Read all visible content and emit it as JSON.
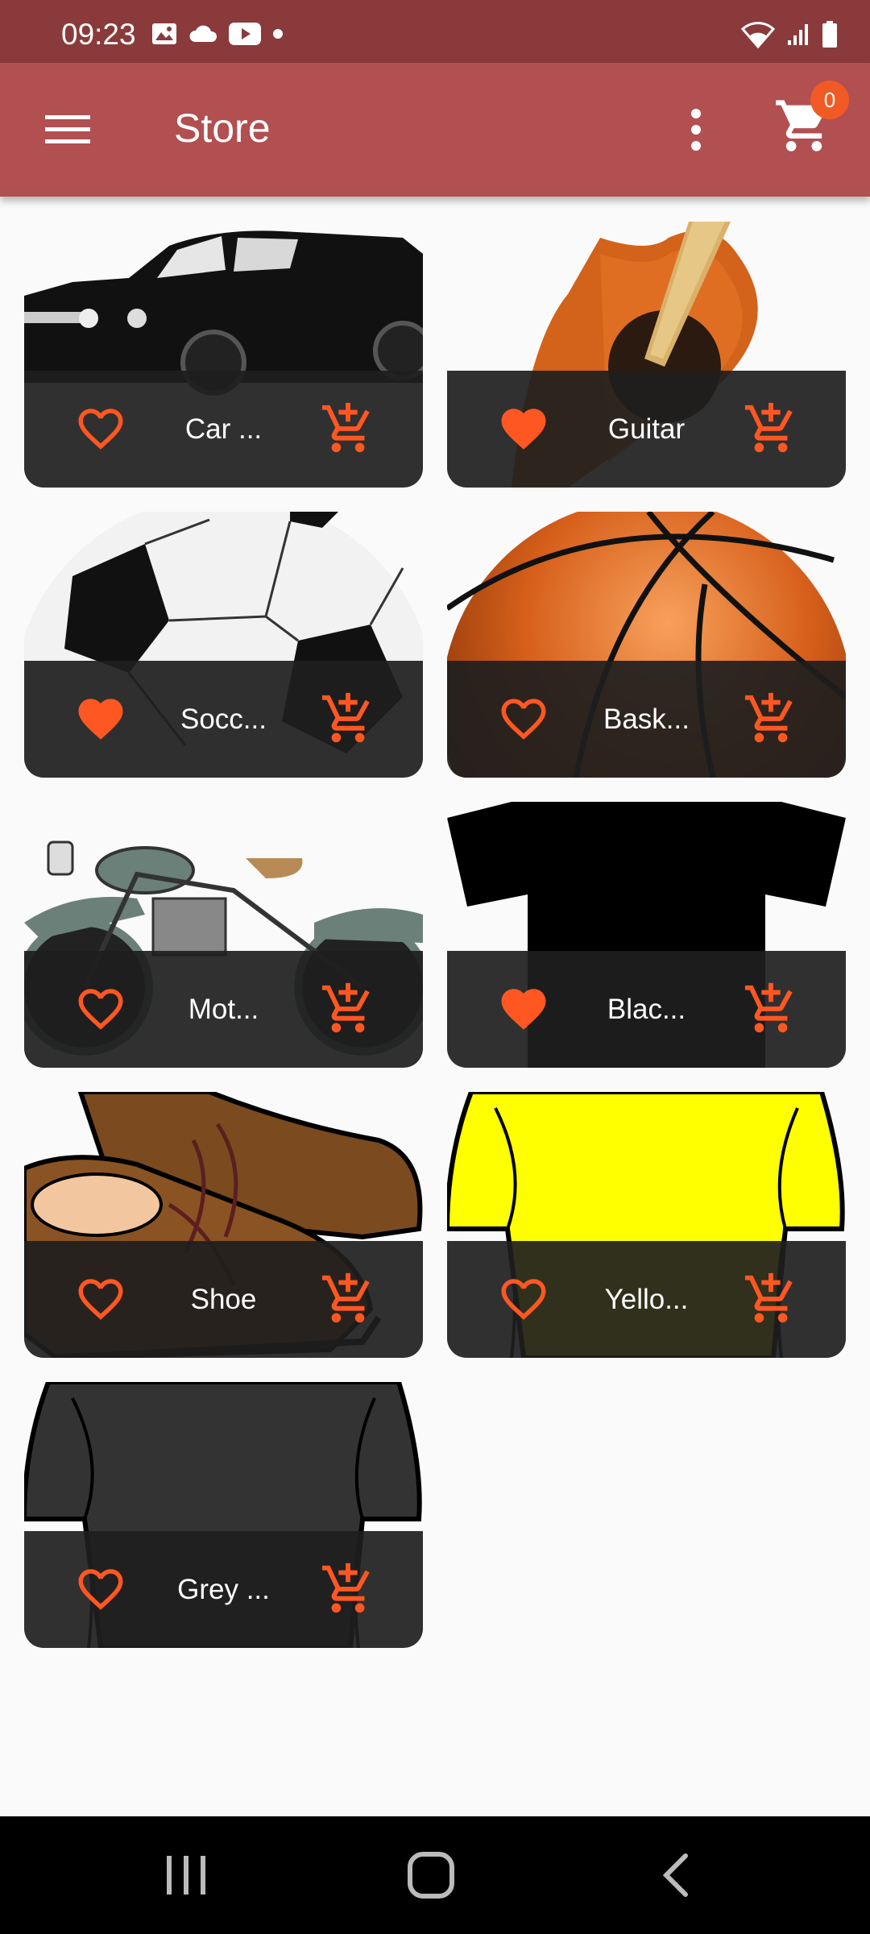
{
  "status": {
    "time": "09:23"
  },
  "app_bar": {
    "title": "Store",
    "cart_count": "0"
  },
  "products": [
    {
      "name": "Car ...",
      "favorite": false
    },
    {
      "name": "Guitar",
      "favorite": true
    },
    {
      "name": "Socc...",
      "favorite": true
    },
    {
      "name": "Bask...",
      "favorite": false
    },
    {
      "name": "Mot...",
      "favorite": false
    },
    {
      "name": "Blac...",
      "favorite": true
    },
    {
      "name": "Shoe",
      "favorite": false
    },
    {
      "name": "Yello...",
      "favorite": false
    },
    {
      "name": "Grey ...",
      "favorite": false
    }
  ],
  "colors": {
    "status_bar": "#8a3a3b",
    "app_bar": "#b14f51",
    "accent": "#ff5722",
    "card_overlay": "#1e1e1e"
  },
  "icons": {
    "menu": "menu-icon",
    "more": "more-vert-icon",
    "cart": "shopping-cart-icon",
    "favorite": "heart-icon",
    "add_to_cart": "add-shopping-cart-icon",
    "nav_recents": "recents-icon",
    "nav_home": "home-icon",
    "nav_back": "back-icon"
  }
}
